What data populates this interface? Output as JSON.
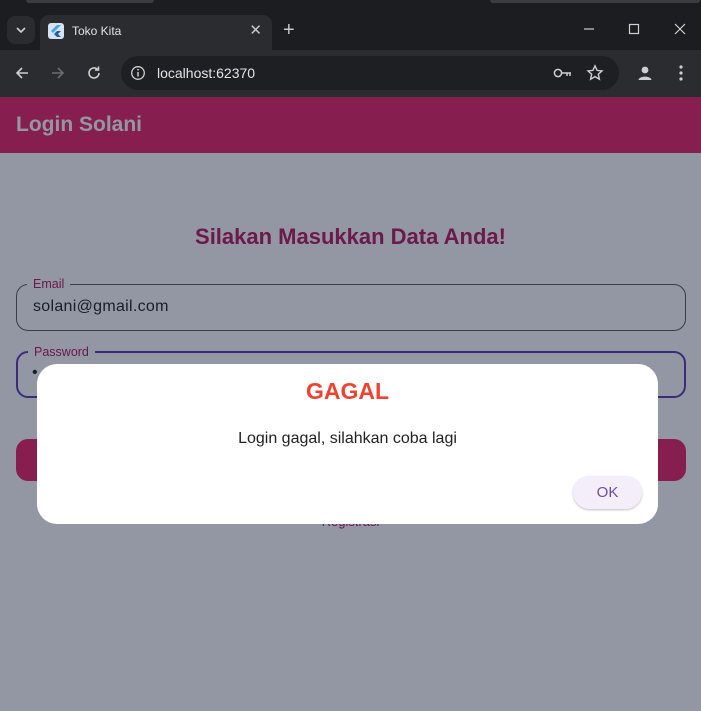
{
  "browser": {
    "tab": {
      "title": "Toko Kita",
      "close": "✕"
    },
    "new_tab": "+",
    "address": {
      "url": "localhost:62370"
    }
  },
  "app": {
    "appbar_title": "Login Solani",
    "heading": "Silakan Masukkan Data Anda!",
    "email": {
      "label": "Email",
      "value": "solani@gmail.com"
    },
    "password": {
      "label": "Password",
      "value": "•"
    },
    "register_link": "Registrasi"
  },
  "dialog": {
    "title": "GAGAL",
    "message": "Login gagal, silahkan coba lagi",
    "ok_label": "OK"
  },
  "colors": {
    "brand": "#e91e63",
    "heading": "#b3155a",
    "dialog_title": "#f0432f",
    "focus_border": "#5e35b1"
  }
}
